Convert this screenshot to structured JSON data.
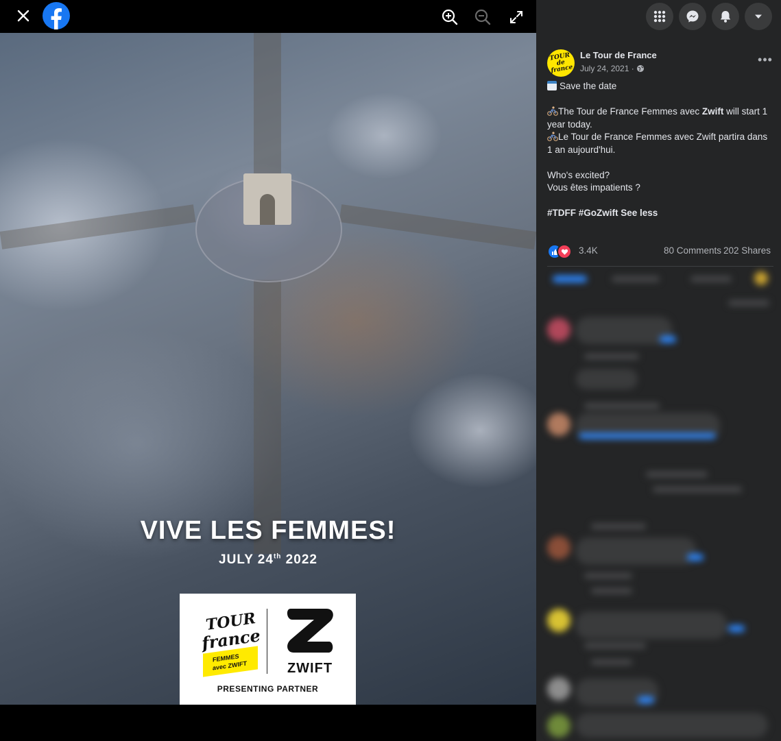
{
  "viewer": {
    "photo": {
      "headline": "VIVE LES FEMMES!",
      "date_main": "JULY 24",
      "date_suffix": "th",
      "date_year": " 2022",
      "logo_tdf_line1": "TOUR",
      "logo_tdf_line2": "france",
      "logo_tdf_band1": "FEMMES",
      "logo_tdf_band2": "avec ZWIFT",
      "logo_zwift": "ZWIFT",
      "partner_label": "PRESENTING PARTNER"
    }
  },
  "post": {
    "avatar_text": "TOUR de france",
    "page_name": "Le Tour de France",
    "date": "July 24, 2021 · ",
    "more_label": "•••",
    "line1": "Save the date",
    "line2_pre": "The Tour de France Femmes avec ",
    "line2_bold": "Zwift",
    "line2_post": " will start 1 year today.",
    "line3": "Le Tour de France Femmes avec Zwift partira dans 1 an aujourd'hui.",
    "line4": "Who's excited?",
    "line5": "Vous êtes impatients ?",
    "hashtags": "#TDFF #GoZwift",
    "see_less": "See less",
    "reaction_count": "3.4K",
    "comments": "80 Comments",
    "shares": "202 Shares"
  },
  "colors": {
    "panel_bg": "#242526",
    "button_bg": "#3a3b3c",
    "fb_blue": "#1877f2",
    "love_red": "#f33e58",
    "tdf_yellow": "#ffe600"
  },
  "icons": [
    "close-icon",
    "facebook-logo-icon",
    "zoom-in-icon",
    "zoom-out-icon",
    "fullscreen-icon",
    "menu-grid-icon",
    "messenger-icon",
    "notifications-icon",
    "account-dropdown-icon",
    "globe-icon",
    "calendar-icon",
    "cyclist-icon",
    "like-reaction-icon",
    "love-reaction-icon"
  ]
}
